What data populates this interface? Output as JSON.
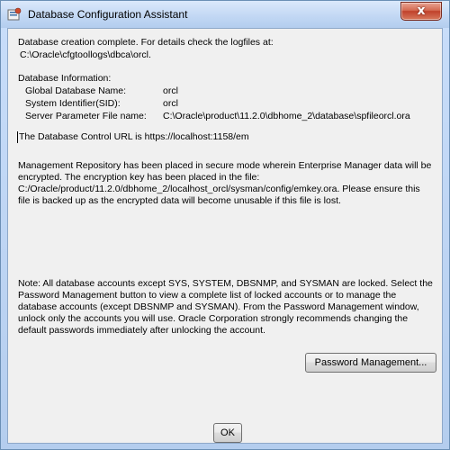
{
  "window": {
    "title": "Database Configuration Assistant",
    "close_label": "x"
  },
  "message": {
    "creation_complete": "Database creation complete. For details check the logfiles at:",
    "logfile_path": "C:\\Oracle\\cfgtoollogs\\dbca\\orcl.",
    "db_info_heading": "Database Information:",
    "global_db_name_label": "Global Database Name:",
    "global_db_name_value": "orcl",
    "sid_label": "System Identifier(SID):",
    "sid_value": "orcl",
    "spfile_label": "Server Parameter File name:",
    "spfile_value": "C:\\Oracle\\product\\11.2.0\\dbhome_2\\database\\spfileorcl.ora",
    "db_control_url": "The Database Control URL is https://localhost:1158/em",
    "repository_paragraph": "Management Repository has been placed in secure mode wherein Enterprise Manager data will be encrypted.  The encryption key has been placed in the file: C:/Oracle/product/11.2.0/dbhome_2/localhost_orcl/sysman/config/emkey.ora.   Please ensure this file is backed up as the encrypted data will become unusable if this file is lost.",
    "note_paragraph": "Note: All database accounts except SYS, SYSTEM, DBSNMP, and SYSMAN are locked. Select the Password Management button to view a complete list of locked accounts or to manage the database accounts (except DBSNMP and SYSMAN). From the Password Management window, unlock only the accounts you will use. Oracle Corporation strongly recommends changing the default passwords immediately after unlocking the account."
  },
  "buttons": {
    "password_management": "Password Management...",
    "ok": "OK"
  }
}
